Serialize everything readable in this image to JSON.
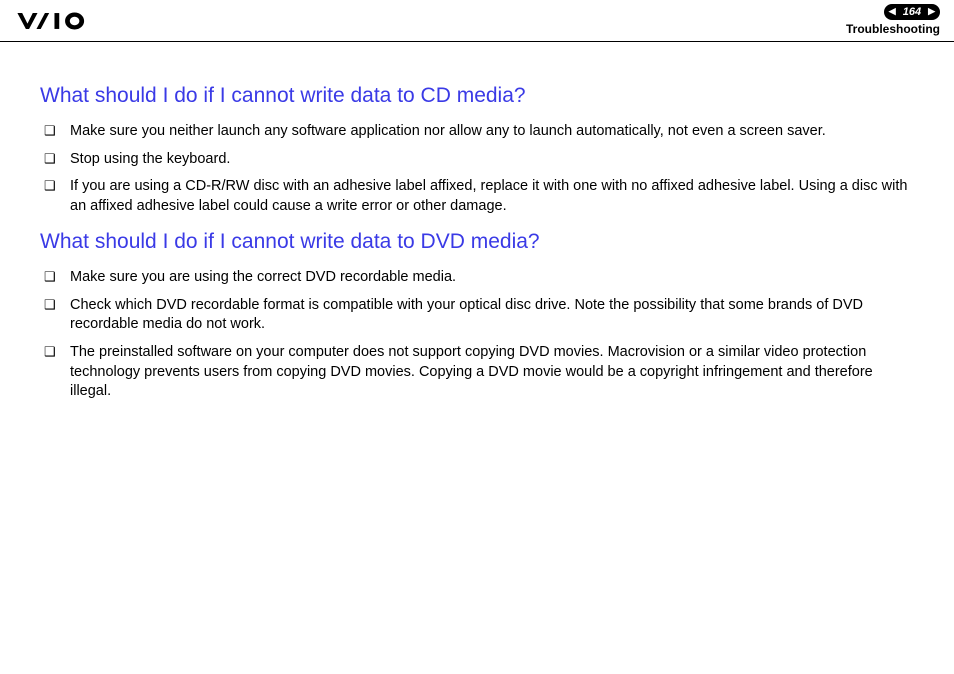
{
  "header": {
    "page_number": "164",
    "section": "Troubleshooting"
  },
  "sections": [
    {
      "heading": "What should I do if I cannot write data to CD media?",
      "items": [
        "Make sure you neither launch any software application nor allow any to launch automatically, not even a screen saver.",
        "Stop using the keyboard.",
        "If you are using a CD-R/RW disc with an adhesive label affixed, replace it with one with no affixed adhesive label. Using a disc with an affixed adhesive label could cause a write error or other damage."
      ]
    },
    {
      "heading": "What should I do if I cannot write data to DVD media?",
      "items": [
        "Make sure you are using the correct DVD recordable media.",
        "Check which DVD recordable format is compatible with your optical disc drive. Note the possibility that some brands of DVD recordable media do not work.",
        "The preinstalled software on your computer does not support copying DVD movies. Macrovision or a similar video protection technology prevents users from copying DVD movies. Copying a DVD movie would be a copyright infringement and therefore illegal."
      ]
    }
  ]
}
